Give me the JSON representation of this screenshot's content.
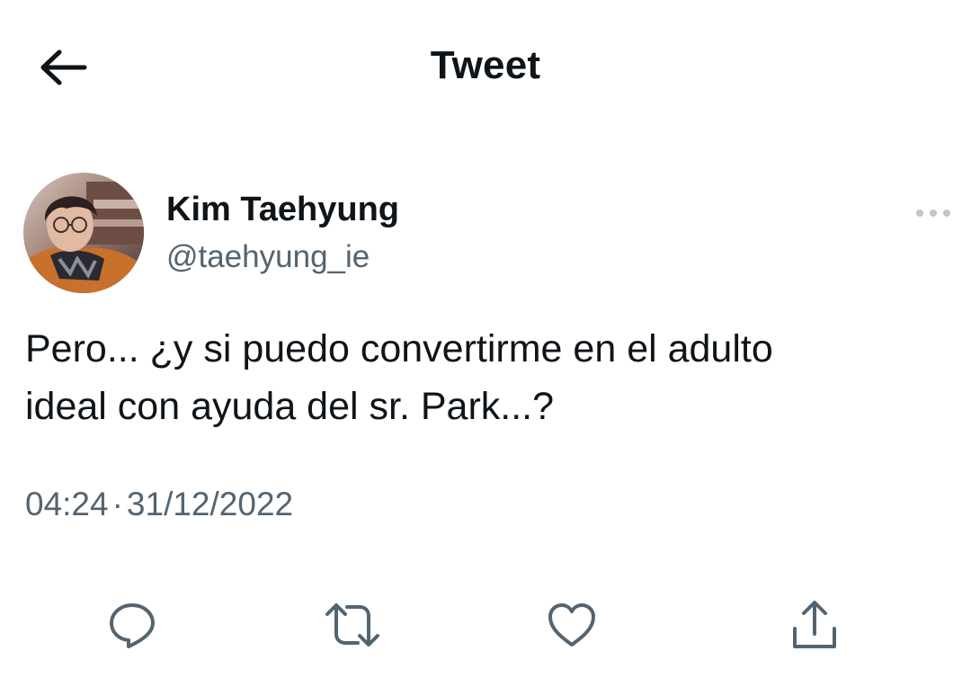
{
  "header": {
    "title": "Tweet",
    "back_icon": "back-arrow-icon"
  },
  "author": {
    "name": "Kim Taehyung",
    "handle": "@taehyung_ie",
    "avatar_icon": "avatar-photo"
  },
  "tweet": {
    "text": "Pero... ¿y si puedo convertirme en el adulto\nideal con ayuda del sr. Park...?",
    "time": "04:24",
    "separator": "·",
    "date": "31/12/2022"
  },
  "actions": {
    "reply_icon": "reply-icon",
    "retweet_icon": "retweet-icon",
    "like_icon": "heart-icon",
    "share_icon": "share-icon",
    "more_icon": "more-options-icon"
  },
  "colors": {
    "text_primary": "#0f1419",
    "text_secondary": "#536471",
    "icon": "#536471",
    "background": "#ffffff"
  }
}
